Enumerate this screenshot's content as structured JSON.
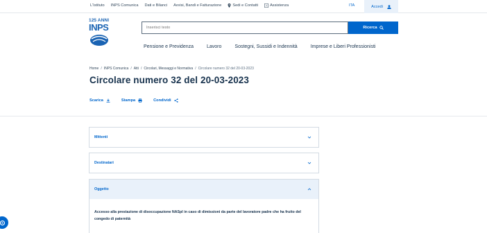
{
  "topbar": {
    "links": [
      "L'Istituto",
      "INPS Comunica",
      "Dati e Bilanci",
      "Avvisi, Bandi e Fatturazione",
      "Sedi e Contatti",
      "Assistenza"
    ],
    "lang": "ITA",
    "login": "Accedi"
  },
  "logo": {
    "line1": "125 ANNI",
    "line2": "INPS"
  },
  "search": {
    "placeholder": "Inserisci testo",
    "button": "Ricerca"
  },
  "mainnav": [
    "Pensione e Previdenza",
    "Lavoro",
    "Sostegni, Sussidi e Indennità",
    "Imprese e Liberi Professionisti"
  ],
  "breadcrumb": [
    "Home",
    "INPS Comunica",
    "Atti",
    "Circolari, Messaggi e Normativa",
    "Circolare numero 32 del 20-03-2023"
  ],
  "title": "Circolare numero 32 del 20-03-2023",
  "actions": {
    "download": "Scarica",
    "print": "Stampa",
    "share": "Condividi"
  },
  "sections": [
    {
      "label": "Mittenti",
      "open": false
    },
    {
      "label": "Destinatari",
      "open": false
    },
    {
      "label": "Oggetto",
      "open": true,
      "body": "Accesso alla prestazione di disoccupazione NASpI in caso di dimissioni da parte del lavoratore padre che ha fruito del congedo di paternità"
    }
  ],
  "colors": {
    "primary": "#0066cc",
    "text": "#17324d",
    "light": "#e9f1fa"
  }
}
